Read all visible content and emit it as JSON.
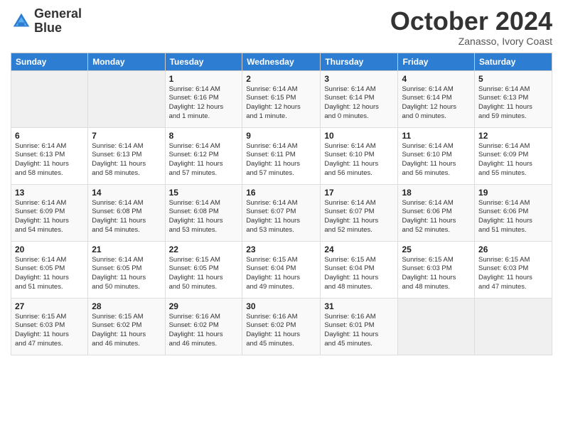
{
  "header": {
    "logo_line1": "General",
    "logo_line2": "Blue",
    "month": "October 2024",
    "location": "Zanasso, Ivory Coast"
  },
  "weekdays": [
    "Sunday",
    "Monday",
    "Tuesday",
    "Wednesday",
    "Thursday",
    "Friday",
    "Saturday"
  ],
  "weeks": [
    [
      {
        "day": "",
        "info": ""
      },
      {
        "day": "",
        "info": ""
      },
      {
        "day": "1",
        "info": "Sunrise: 6:14 AM\nSunset: 6:16 PM\nDaylight: 12 hours\nand 1 minute."
      },
      {
        "day": "2",
        "info": "Sunrise: 6:14 AM\nSunset: 6:15 PM\nDaylight: 12 hours\nand 1 minute."
      },
      {
        "day": "3",
        "info": "Sunrise: 6:14 AM\nSunset: 6:14 PM\nDaylight: 12 hours\nand 0 minutes."
      },
      {
        "day": "4",
        "info": "Sunrise: 6:14 AM\nSunset: 6:14 PM\nDaylight: 12 hours\nand 0 minutes."
      },
      {
        "day": "5",
        "info": "Sunrise: 6:14 AM\nSunset: 6:13 PM\nDaylight: 11 hours\nand 59 minutes."
      }
    ],
    [
      {
        "day": "6",
        "info": "Sunrise: 6:14 AM\nSunset: 6:13 PM\nDaylight: 11 hours\nand 58 minutes."
      },
      {
        "day": "7",
        "info": "Sunrise: 6:14 AM\nSunset: 6:13 PM\nDaylight: 11 hours\nand 58 minutes."
      },
      {
        "day": "8",
        "info": "Sunrise: 6:14 AM\nSunset: 6:12 PM\nDaylight: 11 hours\nand 57 minutes."
      },
      {
        "day": "9",
        "info": "Sunrise: 6:14 AM\nSunset: 6:11 PM\nDaylight: 11 hours\nand 57 minutes."
      },
      {
        "day": "10",
        "info": "Sunrise: 6:14 AM\nSunset: 6:10 PM\nDaylight: 11 hours\nand 56 minutes."
      },
      {
        "day": "11",
        "info": "Sunrise: 6:14 AM\nSunset: 6:10 PM\nDaylight: 11 hours\nand 56 minutes."
      },
      {
        "day": "12",
        "info": "Sunrise: 6:14 AM\nSunset: 6:09 PM\nDaylight: 11 hours\nand 55 minutes."
      }
    ],
    [
      {
        "day": "13",
        "info": "Sunrise: 6:14 AM\nSunset: 6:09 PM\nDaylight: 11 hours\nand 54 minutes."
      },
      {
        "day": "14",
        "info": "Sunrise: 6:14 AM\nSunset: 6:08 PM\nDaylight: 11 hours\nand 54 minutes."
      },
      {
        "day": "15",
        "info": "Sunrise: 6:14 AM\nSunset: 6:08 PM\nDaylight: 11 hours\nand 53 minutes."
      },
      {
        "day": "16",
        "info": "Sunrise: 6:14 AM\nSunset: 6:07 PM\nDaylight: 11 hours\nand 53 minutes."
      },
      {
        "day": "17",
        "info": "Sunrise: 6:14 AM\nSunset: 6:07 PM\nDaylight: 11 hours\nand 52 minutes."
      },
      {
        "day": "18",
        "info": "Sunrise: 6:14 AM\nSunset: 6:06 PM\nDaylight: 11 hours\nand 52 minutes."
      },
      {
        "day": "19",
        "info": "Sunrise: 6:14 AM\nSunset: 6:06 PM\nDaylight: 11 hours\nand 51 minutes."
      }
    ],
    [
      {
        "day": "20",
        "info": "Sunrise: 6:14 AM\nSunset: 6:05 PM\nDaylight: 11 hours\nand 51 minutes."
      },
      {
        "day": "21",
        "info": "Sunrise: 6:14 AM\nSunset: 6:05 PM\nDaylight: 11 hours\nand 50 minutes."
      },
      {
        "day": "22",
        "info": "Sunrise: 6:15 AM\nSunset: 6:05 PM\nDaylight: 11 hours\nand 50 minutes."
      },
      {
        "day": "23",
        "info": "Sunrise: 6:15 AM\nSunset: 6:04 PM\nDaylight: 11 hours\nand 49 minutes."
      },
      {
        "day": "24",
        "info": "Sunrise: 6:15 AM\nSunset: 6:04 PM\nDaylight: 11 hours\nand 48 minutes."
      },
      {
        "day": "25",
        "info": "Sunrise: 6:15 AM\nSunset: 6:03 PM\nDaylight: 11 hours\nand 48 minutes."
      },
      {
        "day": "26",
        "info": "Sunrise: 6:15 AM\nSunset: 6:03 PM\nDaylight: 11 hours\nand 47 minutes."
      }
    ],
    [
      {
        "day": "27",
        "info": "Sunrise: 6:15 AM\nSunset: 6:03 PM\nDaylight: 11 hours\nand 47 minutes."
      },
      {
        "day": "28",
        "info": "Sunrise: 6:15 AM\nSunset: 6:02 PM\nDaylight: 11 hours\nand 46 minutes."
      },
      {
        "day": "29",
        "info": "Sunrise: 6:16 AM\nSunset: 6:02 PM\nDaylight: 11 hours\nand 46 minutes."
      },
      {
        "day": "30",
        "info": "Sunrise: 6:16 AM\nSunset: 6:02 PM\nDaylight: 11 hours\nand 45 minutes."
      },
      {
        "day": "31",
        "info": "Sunrise: 6:16 AM\nSunset: 6:01 PM\nDaylight: 11 hours\nand 45 minutes."
      },
      {
        "day": "",
        "info": ""
      },
      {
        "day": "",
        "info": ""
      }
    ]
  ]
}
